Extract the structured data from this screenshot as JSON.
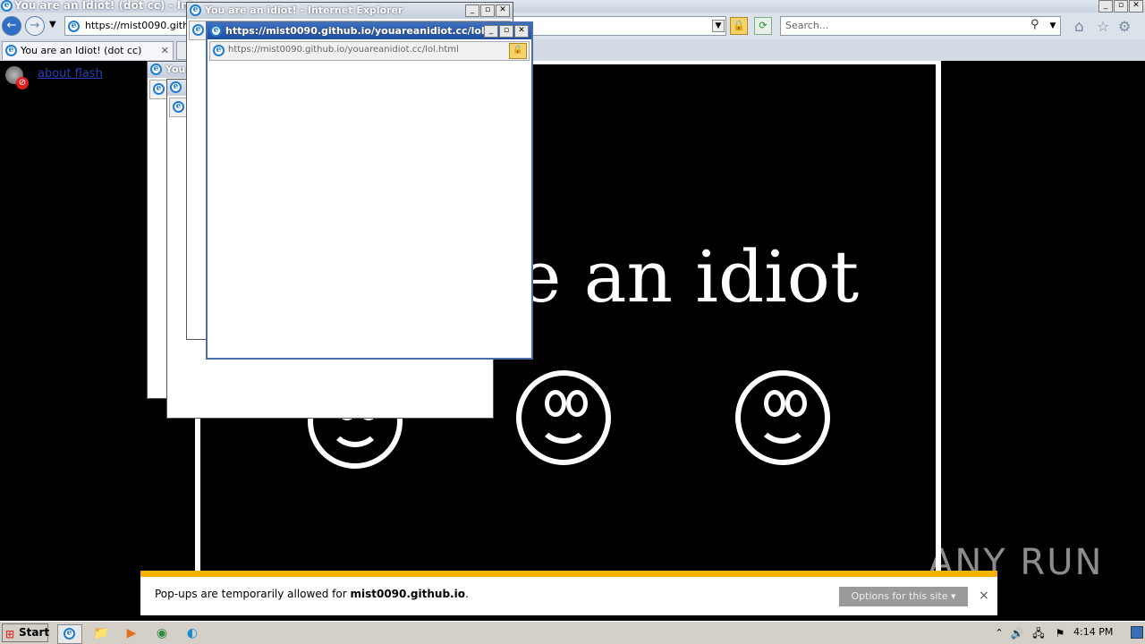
{
  "window": {
    "title": "You are an Idiot! (dot cc) - Interne",
    "address": "https://mist0090.github.io/youareanidiot.cc/",
    "address_visible": "https://mist0090.github",
    "search_placeholder": "Search...",
    "tab_label": "You are an Idiot! (dot cc)"
  },
  "page": {
    "flash_link": "about flash",
    "big_text": "e an idiot",
    "smileys": 3
  },
  "popups": [
    {
      "title": "You",
      "address": ""
    },
    {
      "title": "",
      "address": ""
    },
    {
      "title": "You are an idiot! - Internet Explorer",
      "address": ""
    },
    {
      "title": "https://mist0090.github.io/youareanidiot.cc/lol...",
      "address": "https://mist0090.github.io/youareanidiot.cc/lol.html"
    }
  ],
  "notification": {
    "prefix": "Pop-ups are temporarily allowed for ",
    "site": "mist0090.github.io",
    "suffix": ".",
    "options_label": "Options for this site ▾",
    "close": "×"
  },
  "taskbar": {
    "start": "Start",
    "clock": "4:14 PM"
  },
  "watermark": "ANY RUN"
}
